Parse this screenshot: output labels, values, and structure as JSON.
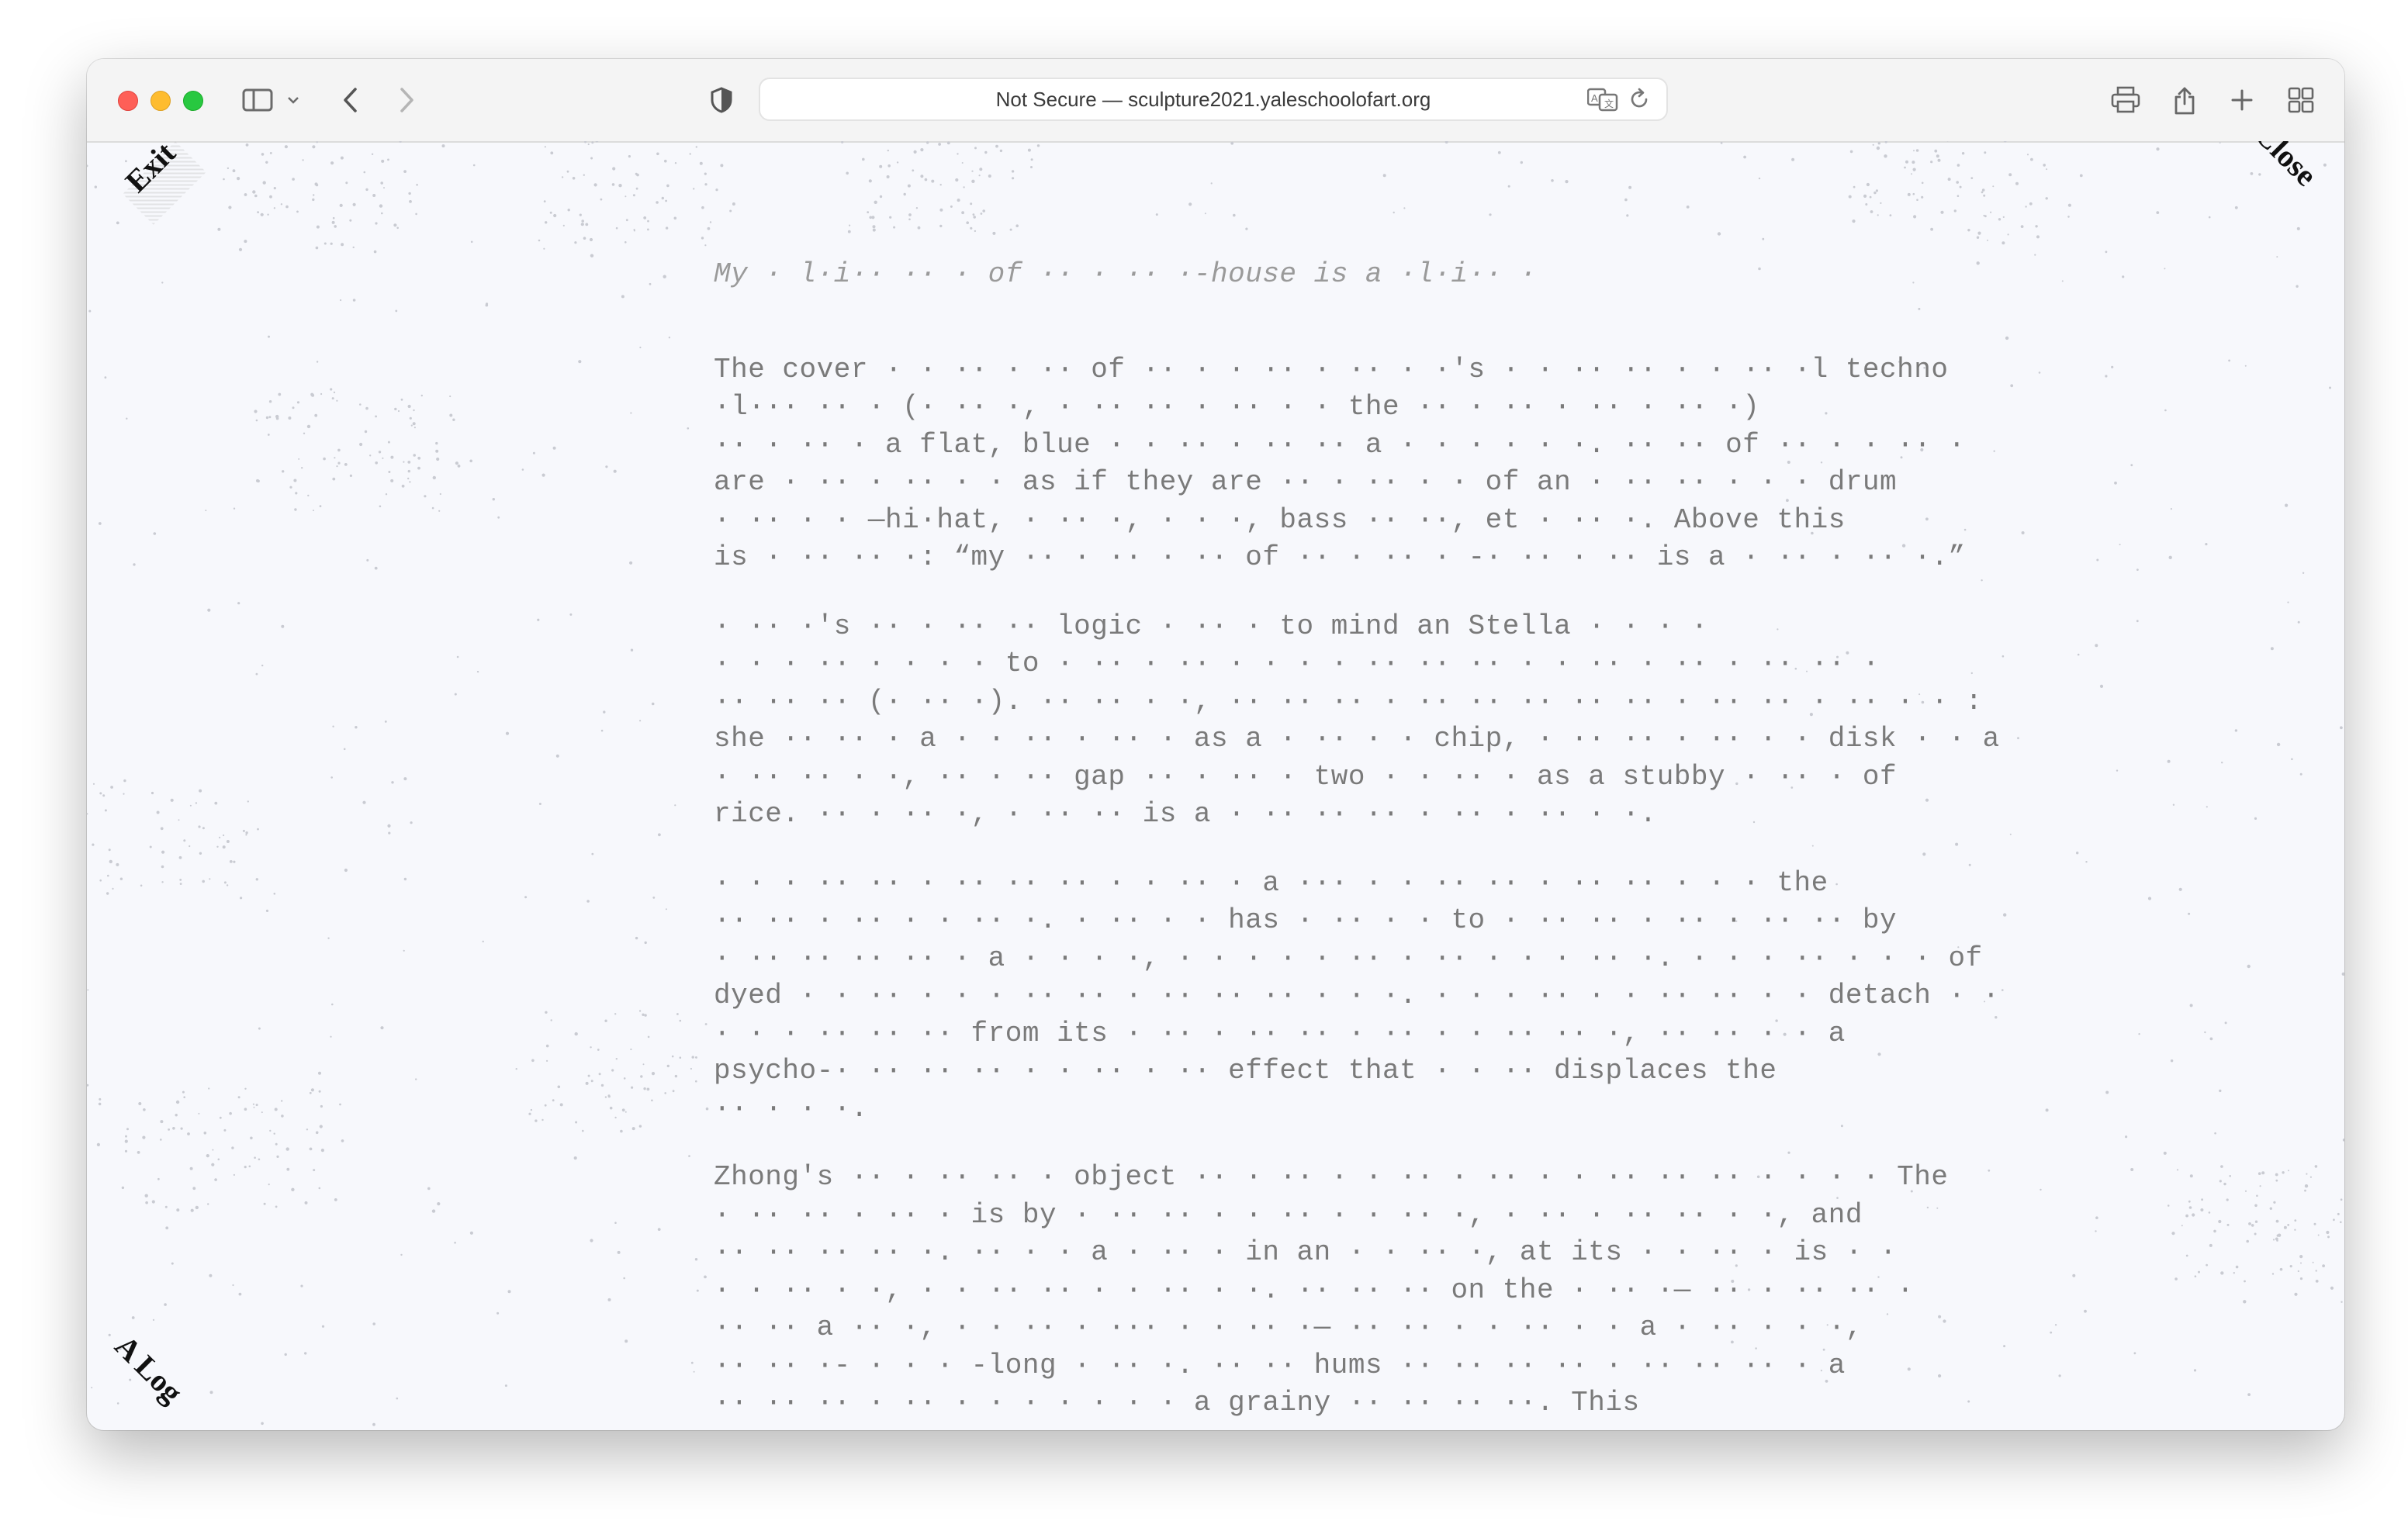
{
  "browser": {
    "address": "Not Secure — sculpture2021.yaleschoolofart.org",
    "icons": {
      "sidebar": "sidebar-icon",
      "chevron": "chevron-down-icon",
      "back": "back-icon",
      "forward": "forward-icon",
      "privacy": "shield-icon",
      "translate": "translate-icon",
      "reload": "reload-icon",
      "print": "print-icon",
      "share": "share-icon",
      "new_tab": "plus-icon",
      "tabs": "tab-overview-icon"
    },
    "traffic_lights": {
      "close": "#fe5f57",
      "minimize": "#febc2e",
      "zoom": "#28c840"
    }
  },
  "page": {
    "nav": {
      "exit": "Exit",
      "close": "Close",
      "log": "A Log"
    },
    "heading": "My · l·i·· ·· · of ·· · ·· ·-house is a ·l·i·· ·",
    "paragraphs": [
      [
        "The cover · · ·· · ·· of ·· · · ·· · ·· · ·'s · · ·· ·· · · ·· ·l techno",
        "·l··· ·· · (· ·· ·, · ·· ·· · ·· · · the ·· · ·· · ·· · ·· ·)",
        "·· · ·· · a flat, blue · · ·· · ·· ·· a · · · · · ·. ·· ·· of ·· · · ·· ·",
        "are · ·· · ·· · · as if they are ·· · ·· · · of an · ·· ·· · · · drum",
        "· ·· · · —hi·hat, · ·· ·, · · ·, bass ·· ··, et · ·· ·. Above this",
        "is · ·· ·· ·: “my ·· · ·· · ·· of ·· · ·· · -· ·· · ·· is a · ·· · ·· ·.”"
      ],
      [
        "· ·· ·'s ·· · ·· ·· logic · ·· · to mind an Stella · · · ·",
        "· · · ·· · · · · to · ·· · ·· · · · · ·· ·· ·· · · ·· · ·· · ·· ·· ·",
        "·· ·· ·· (· ·· ·). ·· ·· · ·, ·· ·· ·· · ·· ·· ·· ·· ·· · ·· ·· · ·· · · :",
        "she ·· ·· · a · · ·· · ·· · as a · ·· · · chip, · ·· ·· · ·· · · disk · · a",
        "· ·· ·· · ·, ·· · ·· gap ·· · ·· · two · · ·· · as a stubby · ·· · of",
        "rice. ·· · ·· ·, · ·· ·· is a · ·· ·· ·· · ·· · ·· · ·."
      ],
      [
        "· · · ·· ·· · ·· ·· ·· · · ·· · a ··· · · ·· ·· · ·· ·· · · · the",
        "·· ·· · ·· · · ·· ·. · ·· · · has · ·· · · to · ·· ·· · ·· · ·· ·· by",
        "· ·· ·· ·· ·· · a · · · ·, · · · · · ·· · ·· · · · ·· ·. · · · ·· · · · of",
        "dyed · · ·· · · · ·· ·· · ·· ·· ·· · · ·. · · · ·· · · ·· ·· · · detach · ·",
        "· · · ·· ·· ·· from its · ·· · ·· ·· · ·· · · ·· ·· ·, ·· ·· · · a",
        "psycho-· ·· ·· ·· · · ·· · ·· effect that · · ·· displaces the",
        "·· · · ·."
      ],
      [
        "Zhong's ·· · ·· ·· · object ·· · ·· · · ·· · ·· · · ·· ·· ·· · · · · The",
        "· ·· ·· · ·· · is by · ·· ·· · · ·· · · ·· ·, · ·· · ·· ·· · ·, and",
        "·· ·· ·· ·· ·. ·· · · a · ·· · in an · · ·· ·, at its · · ·· · is · ·",
        "· · ·· · ·, · · ·· ·· · · ·· · ·. ·· ·· ·· on the · ·· ·— ·· · ·· ·· ·",
        "·· ·· a ·· ·, · · ·· · ··· · · ·· ·— ·· ·· · · ·· · · a · ·· · · ·,",
        "·· ·· ·- · · · -long · ·· ·. ·· ·· hums ·· ·· ·· ·· · ·· ·· ·· · a",
        "·· ·· ·· · ·· · · · · · · · a grainy ·· ·· ·· ··. This"
      ]
    ]
  }
}
